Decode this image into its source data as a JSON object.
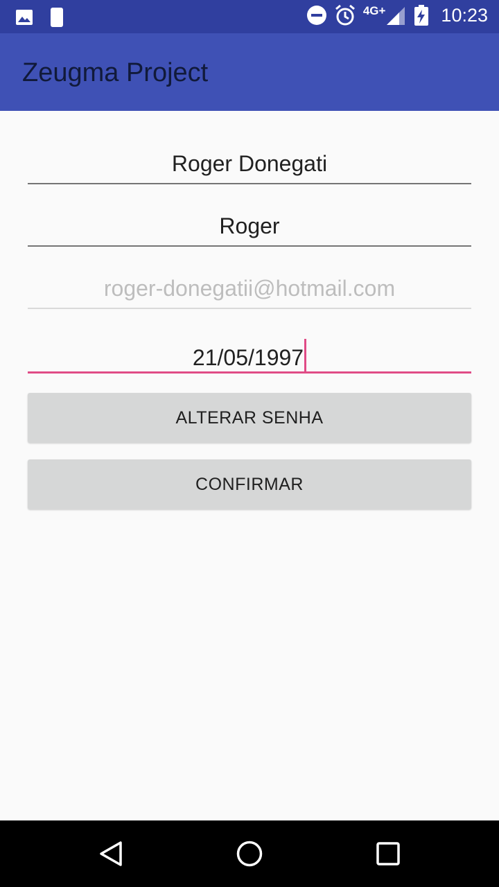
{
  "status_bar": {
    "network": "4G+",
    "time": "10:23",
    "icons": [
      "image-icon",
      "phone-icon",
      "dnd-icon",
      "alarm-icon",
      "signal-icon",
      "battery-charging-icon"
    ]
  },
  "app_bar": {
    "title": "Zeugma Project"
  },
  "form": {
    "name_value": "Roger Donegati",
    "nickname_value": "Roger",
    "email_hint": "roger-donegatii@hotmail.com",
    "birthdate_value": "21/05/1997",
    "change_password_label": "ALTERAR SENHA",
    "confirm_label": "CONFIRMAR"
  },
  "nav_bar": {
    "icons": [
      "back-icon",
      "home-icon",
      "recents-icon"
    ]
  },
  "colors": {
    "status_bar": "#303f9f",
    "app_bar": "#3f51b5",
    "accent": "#e04b86",
    "button": "#d6d7d7"
  }
}
